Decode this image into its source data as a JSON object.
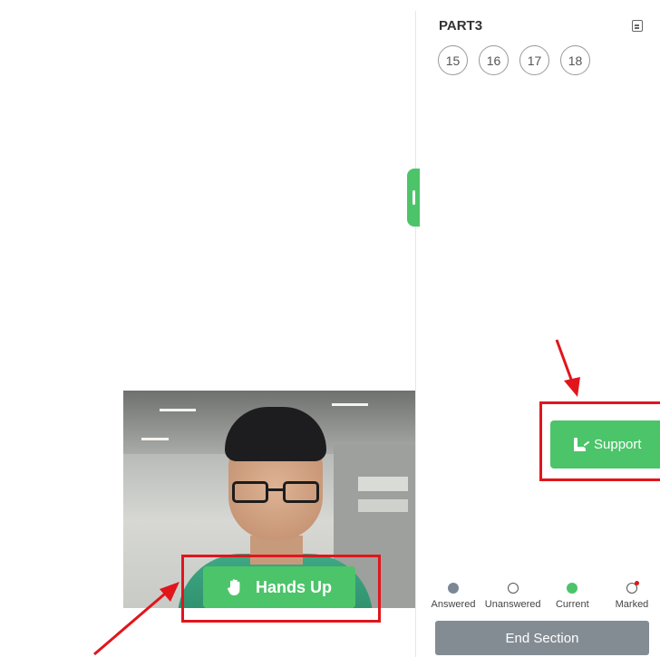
{
  "sidebar": {
    "part_title": "PART3",
    "questions": [
      "15",
      "16",
      "17",
      "18"
    ],
    "support_label": "Support",
    "legend": [
      {
        "key": "answered",
        "label": "Answered"
      },
      {
        "key": "unanswered",
        "label": "Unanswered"
      },
      {
        "key": "current",
        "label": "Current"
      },
      {
        "key": "marked",
        "label": "Marked"
      }
    ],
    "end_section_label": "End Section"
  },
  "webcam": {
    "hands_up_label": "Hands Up"
  },
  "icons": {
    "note": "note-icon",
    "hand": "hand-icon",
    "support": "support-icon"
  },
  "colors": {
    "accent_green": "#4cc46a",
    "highlight_red": "#e0161c",
    "end_button_gray": "#848c93"
  }
}
